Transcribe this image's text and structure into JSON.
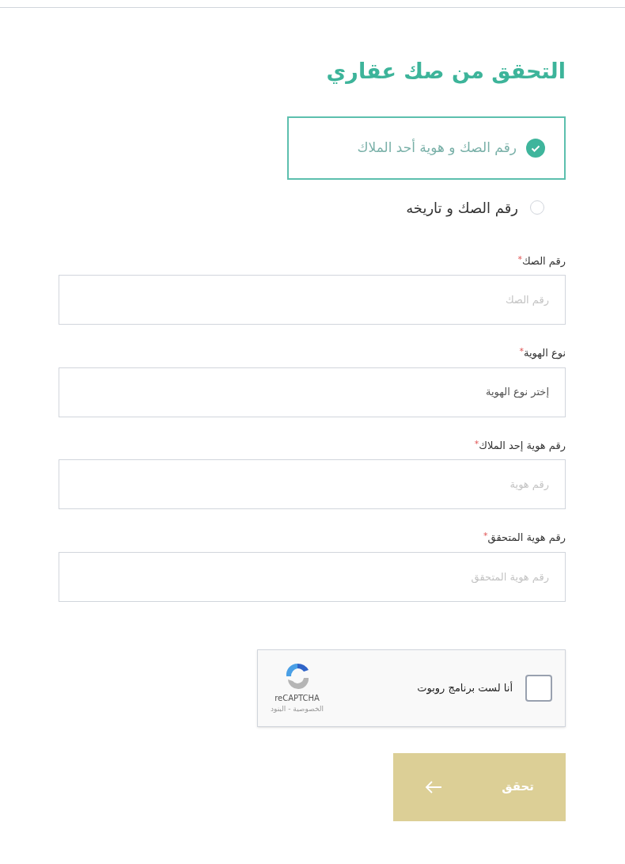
{
  "title": "التحقق من صك عقاري",
  "options": [
    {
      "label": "رقم الصك و هوية أحد الملاك",
      "selected": true
    },
    {
      "label": "رقم الصك و تاريخه",
      "selected": false
    }
  ],
  "fields": [
    {
      "kind": "input",
      "label": "رقم الصك",
      "required_mark": "*",
      "placeholder": "رقم الصك"
    },
    {
      "kind": "select",
      "label": "نوع الهوية",
      "required_mark": "*",
      "value": "إختر نوع الهوية"
    },
    {
      "kind": "input",
      "label": "رقم هوية إحد الملاك",
      "required_mark": "*",
      "placeholder": "رقم هوية"
    },
    {
      "kind": "input",
      "label": "رقم هوية المتحقق",
      "required_mark": "*",
      "placeholder": "رقم هوية المتحقق"
    }
  ],
  "captcha": {
    "label": "أنا لست برنامج روبوت",
    "checked": false,
    "brand": "reCAPTCHA",
    "links": "الخصوصية - البنود"
  },
  "submit": {
    "label": "تحقق"
  }
}
